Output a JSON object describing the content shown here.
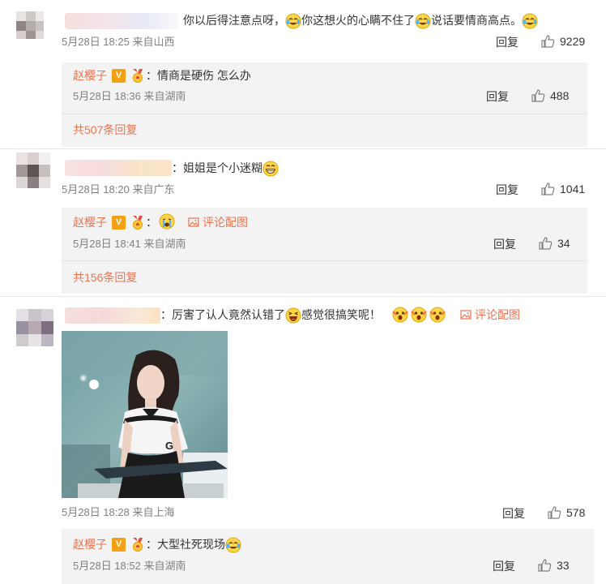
{
  "comments": [
    {
      "text_parts": [
        "你以后得注意点呀，",
        "你这想火的心瞒不住了",
        "说话要情商高点。"
      ],
      "meta": "5月28日 18:25 来自山西",
      "reply_label": "回复",
      "likes": "9229",
      "sub_reply": {
        "author": "赵樱子",
        "text": "：情商是硬伤 怎么办",
        "meta": "5月28日 18:36 来自湖南",
        "reply_label": "回复",
        "likes": "488"
      },
      "total": "共507条回复"
    },
    {
      "text": "：姐姐是个小迷糊",
      "meta": "5月28日 18:20 来自广东",
      "reply_label": "回复",
      "likes": "1041",
      "sub_reply": {
        "author": "赵樱子",
        "text": "：",
        "pic_link": "评论配图",
        "meta": "5月28日 18:41 来自湖南",
        "reply_label": "回复",
        "likes": "34"
      },
      "total": "共156条回复"
    },
    {
      "text_parts": [
        "：厉害了认人竟然认错了",
        "感觉很搞笑呢！"
      ],
      "pic_link": "评论配图",
      "meta": "5月28日 18:28 来自上海",
      "reply_label": "回复",
      "likes": "578",
      "sub_reply": {
        "author": "赵樱子",
        "text": "：大型社死现场",
        "meta": "5月28日 18:52 来自湖南",
        "reply_label": "回复",
        "likes": "33"
      }
    }
  ],
  "badges": {
    "vip": "V"
  },
  "photo": {
    "shirt_letter": "G"
  },
  "colors": {
    "accent": "#eb7350",
    "meta": "#808080",
    "reply_bg": "#f3f3f3",
    "vip_badge": "#f2a014"
  },
  "icons": [
    "thumb-up-icon",
    "image-icon",
    "vip-badge-icon",
    "medal-icon",
    "laugh-cry-emoji",
    "grin-emoji",
    "cry-emoji",
    "laugh-emoji",
    "scream-emoji"
  ]
}
